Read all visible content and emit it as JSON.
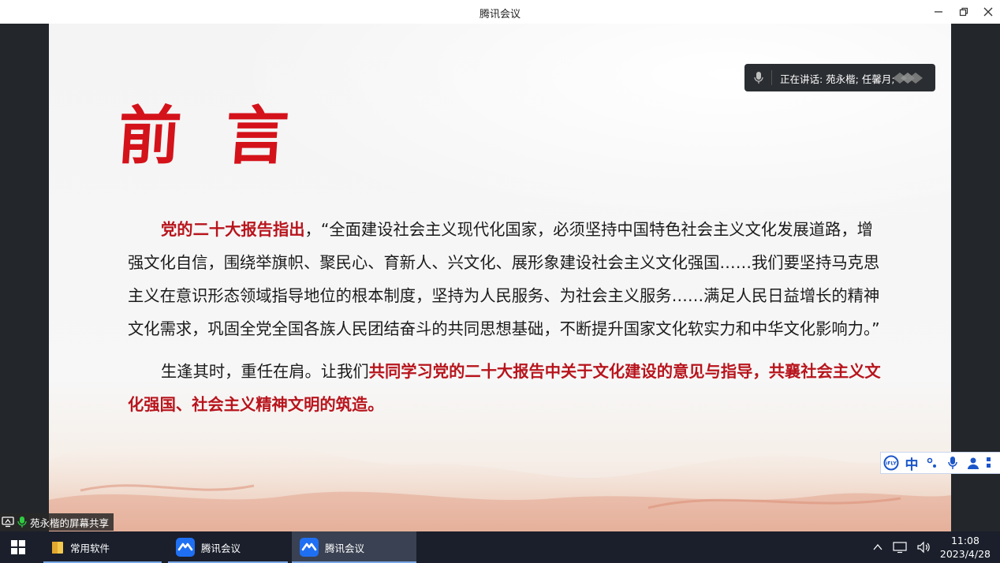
{
  "window": {
    "title": "腾讯会议"
  },
  "slide": {
    "title": "前言",
    "para1_highlight": "党的二十大报告指出",
    "para1_text": "，“全面建设社会主义现代化国家，必须坚持中国特色社会主义文化发展道路，增强文化自信，围绕举旗帜、聚民心、育新人、兴文化、展形象建设社会主义文化强国……我们要坚持马克思主义在意识形态领域指导地位的根本制度，坚持为人民服务、为社会主义服务……满足人民日益增长的精神文化需求，巩固全党全国各族人民团结奋斗的共同思想基础，不断提升国家文化软实力和中华文化影响力。”",
    "para2_text": "生逢其时，重任在肩。让我们",
    "para2_highlight": "共同学习党的二十大报告中关于文化建设的意见与指导，共襄社会主义文化强国、社会主义精神文明的筑造。"
  },
  "speaking": {
    "label": "正在讲话: 苑永楷; 任馨月;"
  },
  "share": {
    "label": "苑永楷的屏幕共享"
  },
  "ime": {
    "lang": "中"
  },
  "taskbar": {
    "items": [
      {
        "label": "常用软件"
      },
      {
        "label": "腾讯会议"
      },
      {
        "label": "腾讯会议"
      }
    ],
    "time": "11:08",
    "date": "2023/4/28"
  },
  "colors": {
    "accent": "#d4121a",
    "highlight": "#b8141c",
    "taskbar": "#1a1f2b"
  }
}
